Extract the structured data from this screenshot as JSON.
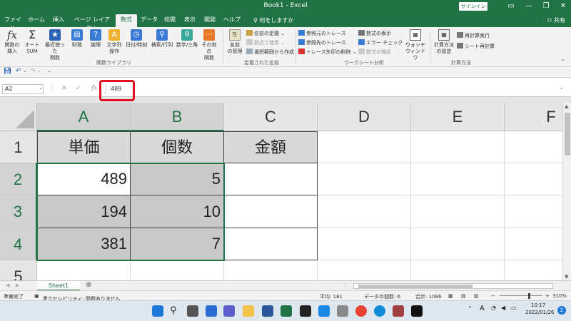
{
  "window": {
    "title": "Book1  -  Excel",
    "signin_label": "サインイン",
    "minimize": "—",
    "restore": "❐",
    "close": "✕"
  },
  "tabs": [
    "ファイル",
    "ホーム",
    "挿入",
    "ページ レイアウト",
    "数式",
    "データ",
    "校閲",
    "表示",
    "開発",
    "ヘルプ"
  ],
  "active_tab": "数式",
  "tell_me": "何をしますか",
  "share": "共有",
  "ribbon": {
    "insert_function": "関数の\n挿入",
    "autosum": "オート\nSUM",
    "recent": "最近使った\n関数",
    "financial": "財務",
    "logical": "論理",
    "text": "文字列\n操作",
    "datetime": "日付/時刻",
    "lookup": "検索/行列",
    "math": "数学/三角",
    "more": "その他の\n関数",
    "name_manager": "名前\nの管理",
    "define_name": "名前の定義",
    "use_in_formula": "数式で使用",
    "create_from_selection": "選択範囲から作成",
    "trace_precedents": "参照元のトレース",
    "trace_dependents": "参照先のトレース",
    "remove_arrows": "トレース矢印の削除",
    "show_formulas": "数式の表示",
    "error_check": "エラー チェック",
    "evaluate_formula": "数式の検証",
    "watch_window": "ウォッチ\nウィンドウ",
    "calc_options": "計算方法\nの設定",
    "calc_now": "再計算実行",
    "calc_sheet": "シート再計算",
    "groups": [
      "関数ライブラリ",
      "定義された名前",
      "ワークシート分析",
      "計算方法"
    ]
  },
  "namebox": "A2",
  "formula_value": "489",
  "fx": "fx",
  "columns": [
    "A",
    "B",
    "C",
    "D",
    "E",
    "F"
  ],
  "rows": [
    "1",
    "2",
    "3",
    "4",
    "5"
  ],
  "table": {
    "headers": [
      "単価",
      "個数",
      "金額"
    ],
    "rows": [
      [
        "489",
        "5",
        ""
      ],
      [
        "194",
        "10",
        ""
      ],
      [
        "381",
        "7",
        ""
      ]
    ]
  },
  "sheet_tab": "Sheet1",
  "add_sheet": "⊕",
  "status": {
    "ready": "準備完了",
    "accessibility": "アクセシビリティ: 問題ありません",
    "average": "平均: 181",
    "count": "データの個数: 6",
    "sum": "合計: 1086",
    "zoom": "310%"
  },
  "taskbar": {
    "time": "10:17",
    "date": "2022/01/26",
    "ime": "A",
    "notifications": "2"
  },
  "colors": {
    "excel_green": "#217346",
    "highlight_red": "#e0141e"
  }
}
